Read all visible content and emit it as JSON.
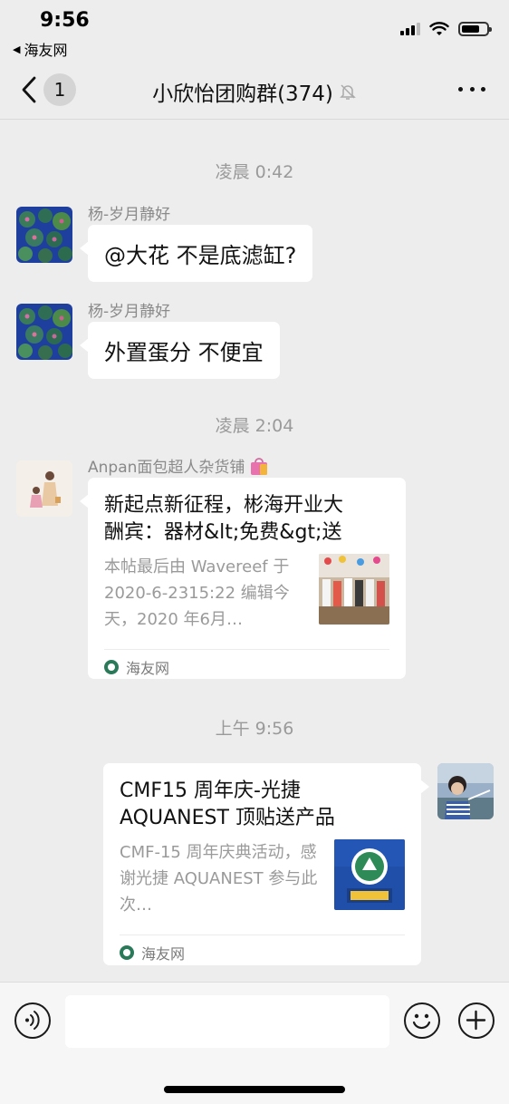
{
  "status_bar": {
    "time": "9:56",
    "back_app": "海友网"
  },
  "nav": {
    "unread_count": "1",
    "title": "小欣怡团购群(374)"
  },
  "messages": {
    "sep1": "凌晨 0:42",
    "msg1": {
      "sender": "杨-岁月静好",
      "text": "@大花 不是底滤缸?"
    },
    "msg2": {
      "sender": "杨-岁月静好",
      "text": "外置蛋分 不便宜"
    },
    "sep2": "凌晨 2:04",
    "card1": {
      "sender": "Anpan面包超人杂货铺",
      "title_line1": "新起点新征程，彬海开业大",
      "title_line2": "酬宾：器材&lt;免费&gt;送",
      "desc": "本帖最后由 Wavereef 于 2020-6-2315:22 编辑今天，2020 年6月…",
      "source": "海友网"
    },
    "sep3": "上午 9:56",
    "card2": {
      "title_line1": "CMF15 周年庆-光捷",
      "title_line2": "AQUANEST 顶贴送产品",
      "desc": "CMF-15 周年庆典活动，感谢光捷 AQUANEST 参与此次…",
      "source": "海友网"
    }
  },
  "input": {
    "placeholder": ""
  },
  "colors": {
    "background": "#ededed",
    "bubble": "#ffffff",
    "timestamp": "#9a9a9a",
    "sender_name": "#8a8a8a"
  },
  "icons": {
    "back": "chevron-left-icon",
    "mute": "bell-slash-icon",
    "more": "more-dots-icon",
    "voice": "voice-icon",
    "emoji": "emoji-icon",
    "plus": "plus-icon",
    "shopping_bag": "shopping-bag-icon"
  }
}
